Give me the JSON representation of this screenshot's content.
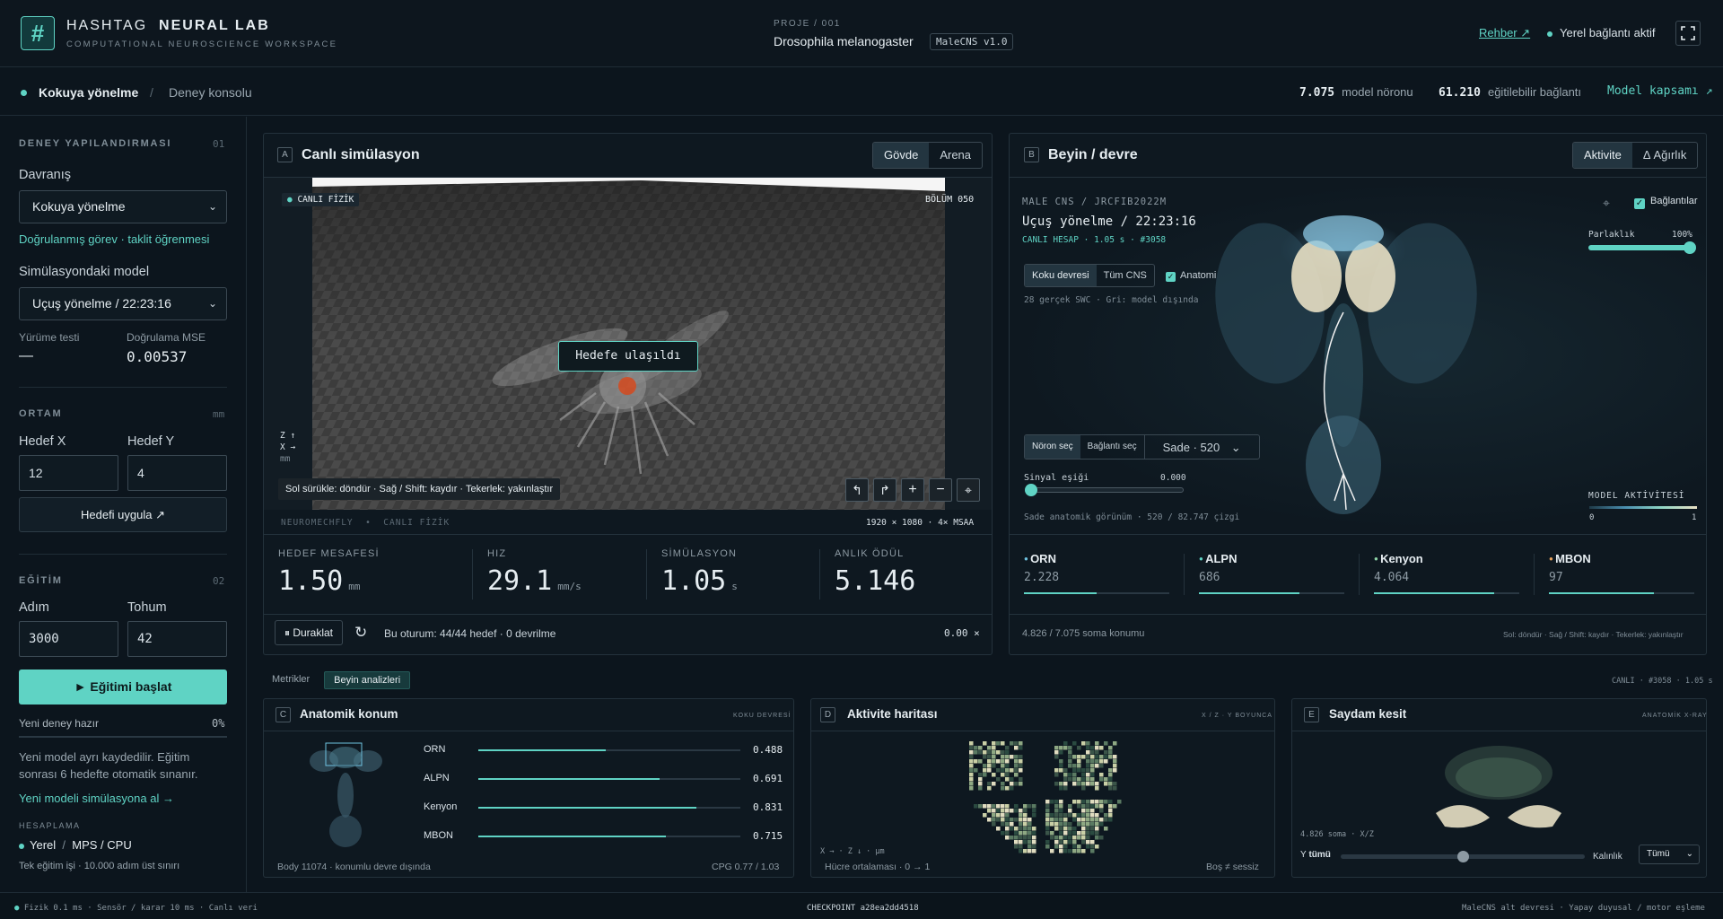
{
  "header": {
    "logo_glyph": "#",
    "brand_light": "HASHTAG",
    "brand_bold": "NEURAL LAB",
    "tagline": "COMPUTATIONAL NEUROSCIENCE WORKSPACE",
    "project_label": "PROJE / 001",
    "project_name": "Drosophila melanogaster",
    "project_version": "MaleCNS v1.0",
    "guide_link": "Rehber ↗",
    "connection_status": "Yerel bağlantı aktif",
    "fullscreen_icon": "fullscreen-icon"
  },
  "subheader": {
    "crumb_active": "Kokuya yönelme",
    "crumb_separator": "/",
    "crumb_page": "Deney konsolu",
    "model_neurons_value": "7.075",
    "model_neurons_label": "model nöronu",
    "trainable_value": "61.210",
    "trainable_label": "eğitilebilir bağlantı",
    "scope_link": "Model kapsamı ↗"
  },
  "sidebar": {
    "config_title": "DENEY YAPILANDIRMASI",
    "config_num": "01",
    "behavior_label": "Davranış",
    "behavior_value": "Kokuya yönelme",
    "behavior_note": "Doğrulanmış görev · taklit öğrenmesi",
    "model_label": "Simülasyondaki model",
    "model_value": "Uçuş yönelme / 22:23:16",
    "walk_test_label": "Yürüme testi",
    "walk_test_value": "—",
    "mse_label": "Doğrulama MSE",
    "mse_value": "0.00537",
    "env_title": "ORTAM",
    "env_unit": "mm",
    "target_x_label": "Hedef X",
    "target_x_value": "12",
    "target_y_label": "Hedef Y",
    "target_y_value": "4",
    "apply_button": "Hedefi uygula ↗",
    "train_title": "EĞİTİM",
    "train_num": "02",
    "step_label": "Adım",
    "step_value": "3000",
    "seed_label": "Tohum",
    "seed_value": "42",
    "start_button": "► Eğitimi başlat",
    "progress_label": "Yeni deney hazır",
    "progress_pct": "0%",
    "progress_value": 0,
    "info_text": "Yeni model ayrı kaydedilir. Eğitim sonrası 6 hedefte otomatik sınanır.",
    "load_link": "Yeni modeli simülasyona al →",
    "compute_title": "HESAPLAMA",
    "compute_mode": "Yerel",
    "compute_sep": "/",
    "compute_device": "MPS / CPU",
    "compute_note": "Tek eğitim işi · 10.000 adım üst sınırı"
  },
  "panel_a": {
    "letter": "A",
    "title": "Canlı simülasyon",
    "tabs": [
      {
        "label": "Gövde",
        "active": true
      },
      {
        "label": "Arena",
        "active": false
      }
    ],
    "live_badge": "CANLI FİZİK",
    "episode": "BÖLÜM 050",
    "target_toast": "Hedefe ulaşıldı",
    "axis_z": "Z ↑",
    "axis_x": "X →",
    "axis_unit": "mm",
    "hint": "Sol sürükle: döndür · Sağ / Shift: kaydır · Tekerlek: yakınlaştır",
    "footer_left_1": "NEUROMECHFLY",
    "footer_dot": "•",
    "footer_left_2": "CANLI FİZİK",
    "footer_right": "1920 × 1080 · 4× MSAA",
    "metrics": [
      {
        "label": "HEDEF MESAFESİ",
        "value": "1.50",
        "unit": "mm"
      },
      {
        "label": "HIZ",
        "value": "29.1",
        "unit": "mm/s"
      },
      {
        "label": "SİMÜLASYON",
        "value": "1.05",
        "unit": "s"
      },
      {
        "label": "ANLIK ÖDÜL",
        "value": "5.146",
        "unit": ""
      }
    ],
    "pause_button": "⏸ Duraklat",
    "session_text": "Bu oturum: 44/44 hedef · 0 devrilme",
    "speed": "0.00 ×"
  },
  "panel_b": {
    "letter": "B",
    "title": "Beyin / devre",
    "tabs": [
      {
        "label": "Aktivite",
        "active": true
      },
      {
        "label": "Δ Ağırlık",
        "active": false
      }
    ],
    "dataset": "MALE CNS / JRCFIB2022M",
    "model_name": "Uçuş yönelme / 22:23:16",
    "live_calc": "CANLI HESAP · 1.05 s · #3058",
    "view_tabs": [
      {
        "label": "Koku devresi",
        "active": true
      },
      {
        "label": "Tüm CNS",
        "active": false
      }
    ],
    "anatomy_label": "Anatomi",
    "swc_note": "28 gerçek SWC · Gri: model dışında",
    "connections_label": "Bağlantılar",
    "brightness_label": "Parlaklık",
    "brightness_value": "100%",
    "brightness_level": 1.0,
    "select_tabs": [
      {
        "label": "Nöron seç",
        "active": true
      },
      {
        "label": "Bağlantı seç",
        "active": false
      }
    ],
    "mode_select": "Sade · 520",
    "threshold_label": "Sinyal eşiği",
    "threshold_value": "0.000",
    "threshold_level": 0.0,
    "view_note": "Sade anatomik görünüm · 520 / 82.747 çizgi",
    "legend_title": "MODEL AKTİVİTESİ",
    "legend_min": "0",
    "legend_max": "1",
    "groups": [
      {
        "name": "ORN",
        "value": "2.228",
        "color": "#6fc3e0",
        "fill": 0.5
      },
      {
        "name": "ALPN",
        "value": "686",
        "color": "#5fd3c4",
        "fill": 0.69
      },
      {
        "name": "Kenyon",
        "value": "4.064",
        "color": "#8fd6a8",
        "fill": 0.83
      },
      {
        "name": "MBON",
        "value": "97",
        "color": "#e6a05a",
        "fill": 0.72
      }
    ],
    "soma_count": "4.826 / 7.075 soma konumu",
    "footer_hint": "Sol: döndür · Sağ / Shift: kaydır · Tekerlek: yakınlaştır"
  },
  "analysis_tabs": [
    {
      "label": "Metrikler",
      "active": false
    },
    {
      "label": "Beyin analizleri",
      "active": true
    }
  ],
  "analysis_status": "CANLI · #3058 · 1.05 s",
  "panel_c": {
    "letter": "C",
    "title": "Anatomik konum",
    "tag": "KOKU DEVRESİ",
    "rows": [
      {
        "name": "ORN",
        "value": "0.488",
        "level": 0.488
      },
      {
        "name": "ALPN",
        "value": "0.691",
        "level": 0.691
      },
      {
        "name": "Kenyon",
        "value": "0.831",
        "level": 0.831
      },
      {
        "name": "MBON",
        "value": "0.715",
        "level": 0.715
      }
    ],
    "footer_left": "Body 11074 · konumlu devre dışında",
    "footer_right": "CPG 0.77 / 1.03"
  },
  "panel_d": {
    "letter": "D",
    "title": "Aktivite haritası",
    "tag": "X / Z · Y BOYUNCA",
    "axis_note": "X → · Z ↓ · µm",
    "footer_left": "Hücre ortalaması · 0 → 1",
    "footer_right": "Boş ≠ sessiz"
  },
  "panel_e": {
    "letter": "E",
    "title": "Saydam kesit",
    "tag": "ANATOMİK X-RAY",
    "soma_note": "4.826 soma · X/Z",
    "y_label": "Y",
    "y_value": "tümü",
    "thickness_label": "Kalınlık",
    "thickness_select": "Tümü",
    "y_level": 0.5
  },
  "statusbar": {
    "left": "Fizik 0.1 ms · Sensör / karar 10 ms · Canlı veri",
    "center": "CHECKPOINT a28ea2dd4518",
    "right": "MaleCNS alt devresi · Yapay duyusal / motor eşleme"
  }
}
